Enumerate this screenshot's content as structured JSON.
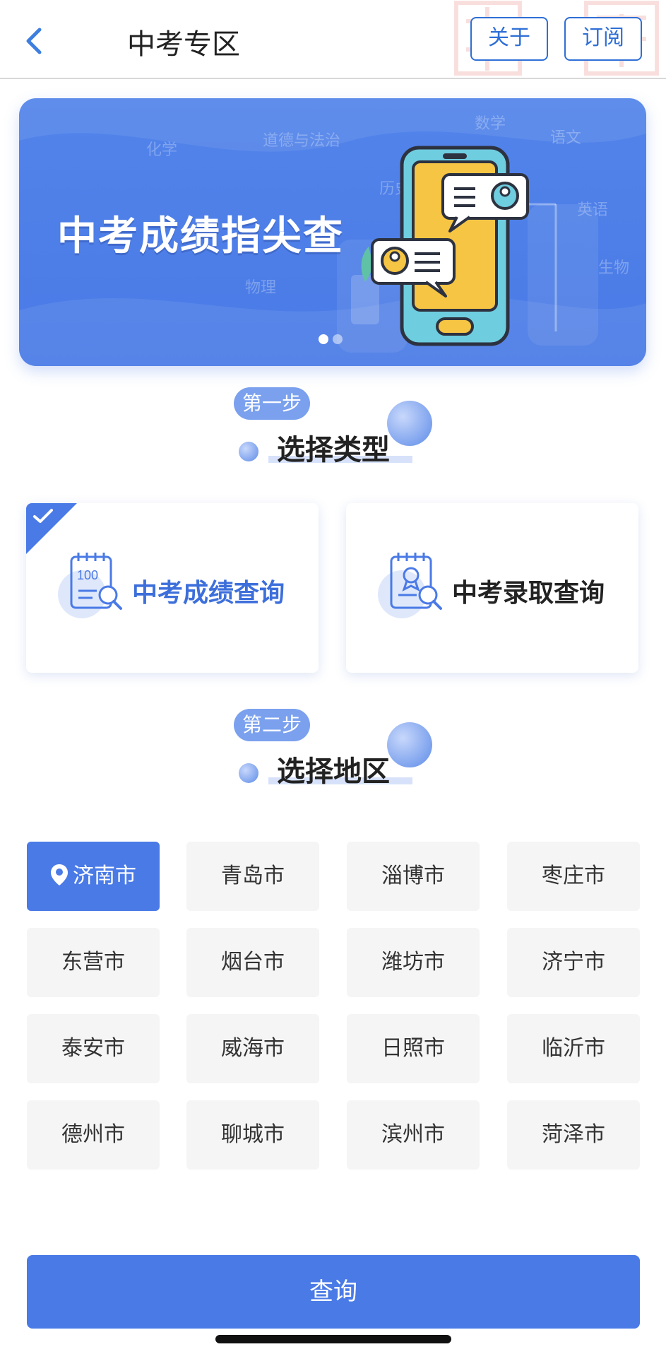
{
  "nav": {
    "title": "中考专区",
    "about_label": "关于",
    "subscribe_label": "订阅"
  },
  "banner": {
    "title": "中考成绩指尖查",
    "subjects": [
      "化学",
      "道德与法治",
      "数学",
      "语文",
      "历史",
      "英语",
      "物理",
      "生物"
    ],
    "active_slide": 1,
    "slide_count": 2
  },
  "step1": {
    "badge": "第一步",
    "heading": "选择类型"
  },
  "types": [
    {
      "label": "中考成绩查询",
      "selected": true
    },
    {
      "label": "中考录取查询",
      "selected": false
    }
  ],
  "step2": {
    "badge": "第二步",
    "heading": "选择地区"
  },
  "cities": [
    "济南市",
    "青岛市",
    "淄博市",
    "枣庄市",
    "东营市",
    "烟台市",
    "潍坊市",
    "济宁市",
    "泰安市",
    "威海市",
    "日照市",
    "临沂市",
    "德州市",
    "聊城市",
    "滨州市",
    "菏泽市"
  ],
  "selected_city": "济南市",
  "query_label": "查询",
  "colors": {
    "accent": "#4a7ae6",
    "accent_text": "#3d6fdb",
    "chip_bg": "#f5f5f5"
  }
}
